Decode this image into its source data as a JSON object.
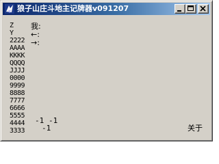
{
  "window": {
    "title": "狼子山庄斗地主记牌器v091207",
    "icon": "app-icon",
    "controls": {
      "minimize_icon": "minimize-icon",
      "maximize_icon": "maximize-icon",
      "close_icon": "close-icon"
    }
  },
  "cards": [
    "Z",
    "Y",
    "2222",
    "AAAA",
    "KKKK",
    "QQQQ",
    "JJJJ",
    "0000",
    "9999",
    "8888",
    "7777",
    "6666",
    "5555",
    "4444",
    "3333"
  ],
  "legend": {
    "me": "我:",
    "left": "←:",
    "right": "→:"
  },
  "counts": {
    "a": "-1",
    "b": "-1",
    "c": "-1"
  },
  "about_label": "关于",
  "colors": {
    "title_start": "#0a246a",
    "title_end": "#a6caf0",
    "face": "#d4d0c8"
  }
}
